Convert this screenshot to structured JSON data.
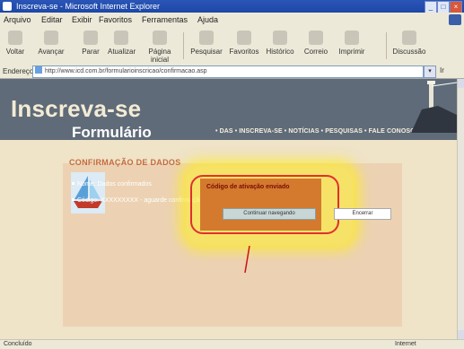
{
  "window": {
    "title": "Inscreva-se - Microsoft Internet Explorer",
    "controls": [
      "_",
      "□",
      "×"
    ]
  },
  "menu": {
    "items": [
      "Arquivo",
      "Editar",
      "Exibir",
      "Favoritos",
      "Ferramentas",
      "Ajuda"
    ]
  },
  "toolbar": {
    "buttons": [
      {
        "label": "Voltar",
        "icon": "back-arrow-icon"
      },
      {
        "label": "Avançar",
        "icon": "forward-arrow-icon"
      },
      {
        "label": "Parar",
        "icon": "stop-icon"
      },
      {
        "label": "Atualizar",
        "icon": "refresh-icon"
      },
      {
        "label": "Página inicial",
        "icon": "home-icon"
      },
      {
        "label": "Pesquisar",
        "icon": "search-icon"
      },
      {
        "label": "Favoritos",
        "icon": "favorites-icon"
      },
      {
        "label": "Histórico",
        "icon": "history-icon"
      },
      {
        "label": "Correio",
        "icon": "mail-icon"
      },
      {
        "label": "Imprimir",
        "icon": "print-icon"
      },
      {
        "label": "Discussão",
        "icon": "discuss-icon"
      }
    ]
  },
  "address": {
    "label": "Endereço",
    "value": "http://www.icd.com.br/formularioinscricao/confirmacao.asp",
    "go_label": "Ir"
  },
  "page": {
    "banner_title": "Inscreva-se",
    "nav_links": "• DAS • INSCREVA-SE • NOTÍCIAS • PESQUISAS • FALE CONOSCO",
    "form_title": "Formulário",
    "confirm_title": "CONFIRMAÇÃO DE DADOS",
    "line1": "Nome: Dados confirmados",
    "line2": "Código: XXXXXXXXX - aguarde confirmação",
    "dialog_msg": "Código de ativação enviado",
    "dialog_button": "Continuar navegando",
    "side_button": "Encerrar"
  },
  "status": {
    "left": "Concluído",
    "right": "Internet"
  },
  "colors": {
    "titlebar": "#2b56b8",
    "banner": "#5f6b78",
    "page_bg": "#efe3c8",
    "panel": "#ecd2b3",
    "dialog": "#d37a2e",
    "highlight_ring": "#e03030",
    "glow": "#ffee28"
  }
}
